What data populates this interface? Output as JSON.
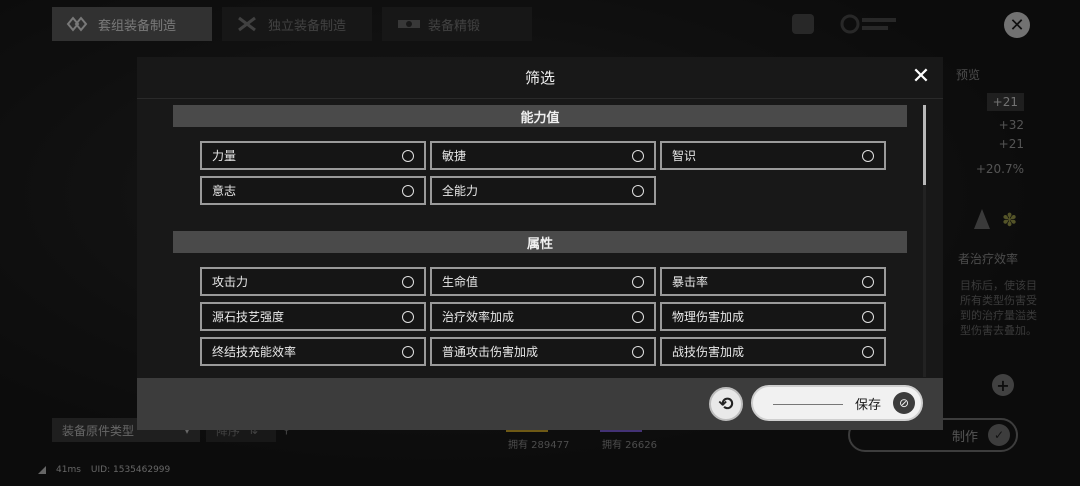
{
  "background": {
    "tabs": [
      {
        "label": "套组装备制造",
        "icon": "suit-forge-icon",
        "active": true
      },
      {
        "label": "独立装备制造",
        "icon": "single-forge-icon",
        "active": false
      },
      {
        "label": "装备精锻",
        "icon": "refine-icon",
        "active": false
      }
    ],
    "preview_label": "预览",
    "stats": [
      "+21",
      "+32",
      "+21",
      "+20.7%"
    ],
    "right_heading": "者治疗效率",
    "right_desc": "目标后，使该目所有类型伤害受到的治疗量溢类型伤害去叠加。",
    "filter_select": "装备原件类型",
    "sort_select": "降序",
    "owned_1": "拥有 289477",
    "owned_2": "拥有 26626",
    "make_label": "制作",
    "status_ping": "41ms",
    "status_uid": "UID: 1535462999"
  },
  "modal": {
    "title": "筛选",
    "sections": [
      {
        "title": "能力值",
        "options": [
          "力量",
          "敏捷",
          "智识",
          "意志",
          "全能力"
        ]
      },
      {
        "title": "属性",
        "options": [
          "攻击力",
          "生命值",
          "暴击率",
          "源石技艺强度",
          "治疗效率加成",
          "物理伤害加成",
          "终结技充能效率",
          "普通攻击伤害加成",
          "战技伤害加成"
        ]
      }
    ],
    "save_label": "保存"
  },
  "colors": {
    "accent_yellow": "#c9a227",
    "accent_purple": "#7b5bd6"
  }
}
